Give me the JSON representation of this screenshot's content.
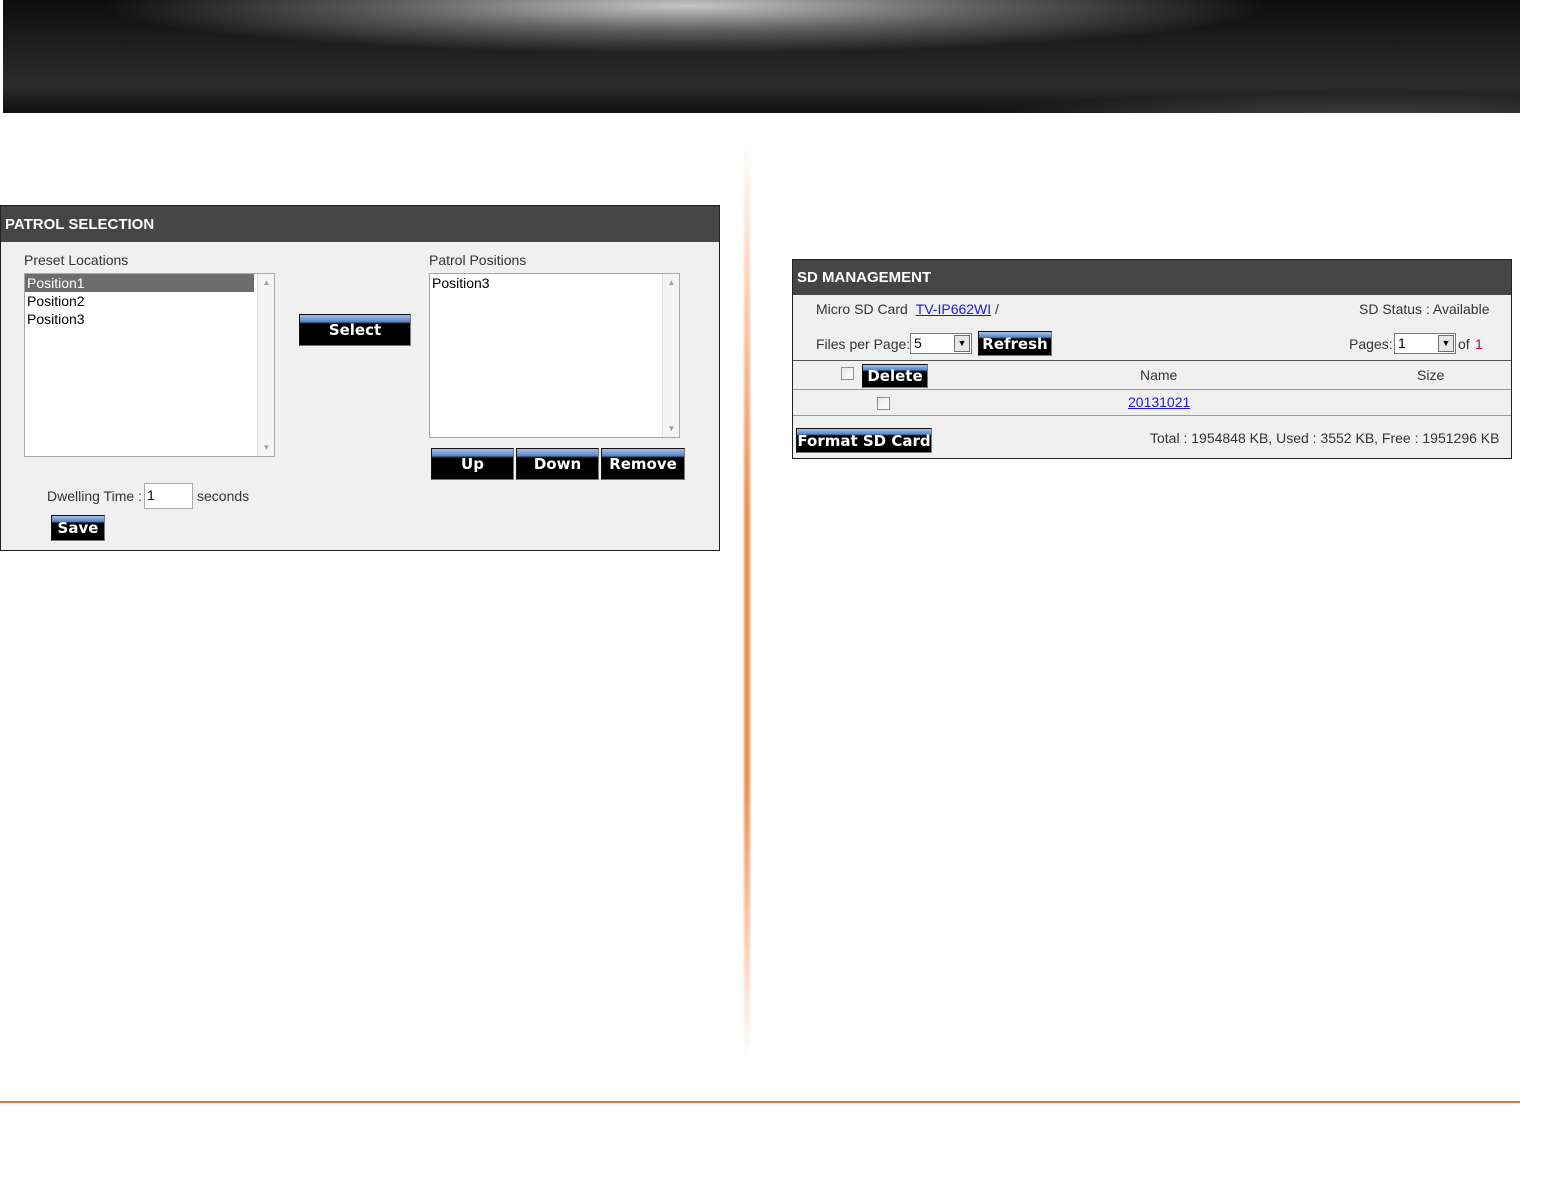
{
  "patrol": {
    "title": "PATROL SELECTION",
    "preset_label": "Preset Locations",
    "preset_items": [
      "Position1",
      "Position2",
      "Position3"
    ],
    "select_label": "Select",
    "patrol_label": "Patrol Positions",
    "patrol_items": [
      "Position3"
    ],
    "up_label": "Up",
    "down_label": "Down",
    "remove_label": "Remove",
    "dwell_label": "Dwelling Time :",
    "dwell_value": "1",
    "seconds_label": "seconds",
    "save_label": "Save"
  },
  "sd": {
    "title": "SD MANAGEMENT",
    "card_label": "Micro SD Card",
    "card_link": "TV-IP662WI",
    "card_slash": "/",
    "status": "SD Status : Available",
    "files_per_page_label": "Files per Page:",
    "files_per_page_value": "5",
    "refresh_label": "Refresh",
    "pages_label": "Pages:",
    "pages_value": "1",
    "of_label": "of",
    "pages_total": "1",
    "delete_label": "Delete",
    "col_name": "Name",
    "col_size": "Size",
    "rows": [
      {
        "name": "20131021",
        "size": ""
      }
    ],
    "format_label": "Format SD Card",
    "usage": "Total :  1954848 KB,  Used :  3552 KB,  Free : 1951296 KB"
  },
  "colors": {
    "accent": "#e07a3a",
    "header": "#454545",
    "link": "#1a1ad6",
    "count": "#c0003a"
  }
}
